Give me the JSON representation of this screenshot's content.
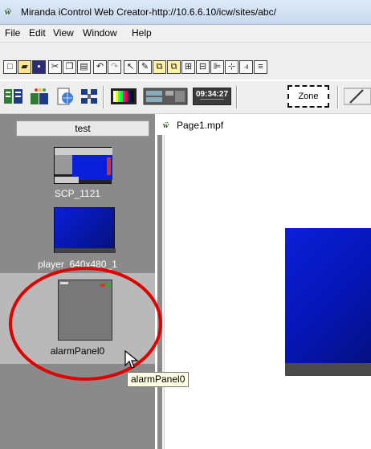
{
  "window": {
    "title": "Miranda iControl Web Creator-http://10.6.6.10/icw/sites/abc/",
    "icon_letter": "ẅ"
  },
  "menu": {
    "items": [
      "File",
      "Edit",
      "View",
      "Window",
      "Help"
    ]
  },
  "toolbar": {
    "clock_text": "09:34:27",
    "zone_label": "Zone"
  },
  "left_panel": {
    "header": "test",
    "assets": [
      {
        "label": "SCP_1121"
      },
      {
        "label": "player_640x480_1"
      },
      {
        "label": "alarmPanel0"
      }
    ]
  },
  "document": {
    "tab_label": "Page1.mpf"
  },
  "tooltip": {
    "text": "alarmPanel0"
  },
  "colors": {
    "accent_blue": "#0616b6",
    "highlight_red": "#e00000",
    "panel_gray": "#8a8a8a"
  }
}
